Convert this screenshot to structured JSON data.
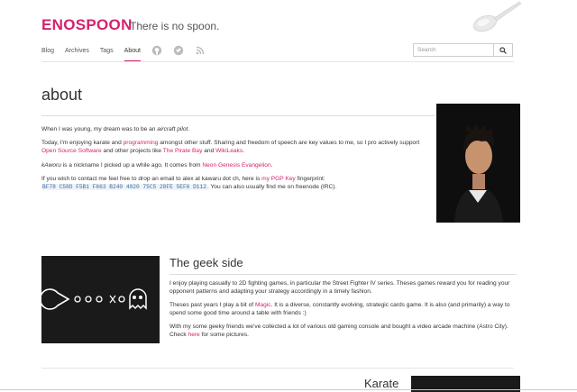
{
  "header": {
    "brand": "ENOSPOON",
    "tagline": "There is no spoon."
  },
  "nav": {
    "items": [
      {
        "label": "Blog"
      },
      {
        "label": "Archives"
      },
      {
        "label": "Tags"
      },
      {
        "label": "About",
        "active": true
      }
    ],
    "icons": [
      "github-icon",
      "twitter-icon",
      "rss-icon"
    ]
  },
  "search": {
    "placeholder": "Search",
    "icon": "search-icon"
  },
  "about": {
    "title": "about",
    "p1_pre": "When I was young, my dream was to be an ",
    "p1_em": "aircraft pilot",
    "p1_post": ".",
    "p2_pre": "Today, I'm enjoying karate and ",
    "p2_link1": "programming",
    "p2_mid": " amongst other stuff. Sharing and freedom of speech are key values to me, so I pro actively support ",
    "p2_link2": "Open Source Software",
    "p2_mid2": " and other projects like ",
    "p2_link3": "The Pirate Bay",
    "p2_and": " and ",
    "p2_link4": "WikiLeaks",
    "p2_end": ".",
    "p3_em": "kAworu",
    "p3_mid": " is a nickname I picked up a while ago. It comes from ",
    "p3_link": "Neon Genesis Evangelion",
    "p3_end": ".",
    "p4_pre": "If you wish to contact me feel free to drop an email to alex at kawaru dot ch, here is ",
    "p4_link": "my PGP Key",
    "p4_post": " fingerprint:",
    "fingerprint": "BF78 C58D F5B1 F663 B240 4020 75C5 28FE 5EF6 D112",
    "p4_tail": ". You can also usually find me on freenode (IRC)."
  },
  "geek": {
    "title": "The geek side",
    "p1": "I enjoy playing casually to 2D fighting games, in particular the Street Fighter IV series. Theses games reward you for reading your opponent patterns and adapting your strategy accordingly in a timely fashion.",
    "p2_pre": "Theses past years I play a bit of ",
    "p2_link": "Magic",
    "p2_post": ". It is a diverse, constantly evolving, strategic cards game. It is also (and primarily) a way to spend some good time around a table with friends :)",
    "p3_pre": "With my some geeky friends we've collected a lot of various old gaming console and bought a video arcade machine (Astro City). Check ",
    "p3_link": "here",
    "p3_post": " for some pictures."
  },
  "karate": {
    "title": "Karate"
  },
  "colors": {
    "accent": "#d6226e",
    "text": "#333333"
  }
}
